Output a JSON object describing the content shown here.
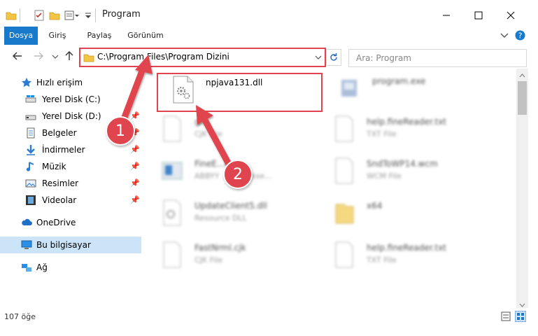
{
  "window": {
    "title": "Program"
  },
  "ribbon": {
    "tabs": [
      "Dosya",
      "Giriş",
      "Paylaş",
      "Görünüm"
    ]
  },
  "address": {
    "path": "C:\\Program Files\\Program Dizini"
  },
  "search": {
    "placeholder": "Ara: Program"
  },
  "sidebar": {
    "items": [
      {
        "label": "Hızlı erişim"
      },
      {
        "label": "Yerel Disk (C:)"
      },
      {
        "label": "Yerel Disk (D:)"
      },
      {
        "label": "Belgeler"
      },
      {
        "label": "İndirmeler"
      },
      {
        "label": "Müzik"
      },
      {
        "label": "Resimler"
      },
      {
        "label": "Videolar"
      },
      {
        "label": "OneDrive"
      },
      {
        "label": "Bu bilgisayar"
      },
      {
        "label": "Ağ"
      }
    ]
  },
  "files": [
    {
      "name": "npjava131.dll",
      "type": ""
    },
    {
      "name": "program.exe",
      "type": ""
    },
    {
      "name": "gl...",
      "type": "CJK File"
    },
    {
      "name": "help.fineReader.txt",
      "type": "TXT File"
    },
    {
      "name": "FineE...e",
      "type": "ABBYY ...ound exe..."
    },
    {
      "name": "SndToWP14.wcm",
      "type": "WCM File"
    },
    {
      "name": "UpdateClient5.dll",
      "type": "Resource DLL"
    },
    {
      "name": "x64",
      "type": ""
    },
    {
      "name": "FastNrml.cjk",
      "type": "CJK File"
    },
    {
      "name": "help.fineReader.txt",
      "type": "TXT File"
    }
  ],
  "status": {
    "count": "107 öğe"
  },
  "annotations": {
    "one": "1",
    "two": "2"
  },
  "colors": {
    "accent": "#1979ca",
    "highlight": "#e0444e"
  }
}
